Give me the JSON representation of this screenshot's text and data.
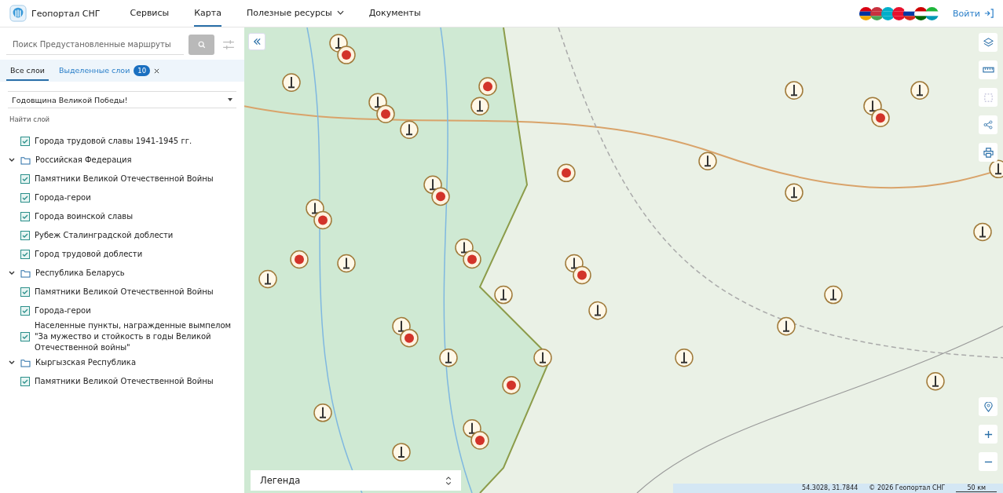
{
  "header": {
    "logo": "Геопортал СНГ",
    "nav": [
      {
        "label": "Сервисы",
        "selected": false,
        "dropdown": false
      },
      {
        "label": "Карта",
        "selected": true,
        "dropdown": false
      },
      {
        "label": "Полезные ресурсы",
        "selected": false,
        "dropdown": true
      },
      {
        "label": "Документы",
        "selected": false,
        "dropdown": false
      }
    ],
    "login": "Войти"
  },
  "sidebar": {
    "search": {
      "placeholder": "Поиск Предустановленные маршруты"
    },
    "tabs": [
      {
        "label": "Все слои",
        "selected": true
      },
      {
        "label": "Выделенные слои",
        "selected": false,
        "count": "10"
      }
    ],
    "preset": "Годовщина Великой Победы!",
    "layer_search": {
      "placeholder": "Найти слой"
    },
    "layers": [
      {
        "kind": "layer",
        "label": "Города трудовой славы 1941-1945 гг.",
        "checked": true
      },
      {
        "kind": "folder",
        "label": "Российская Федерация",
        "expanded": true,
        "children": [
          {
            "label": "Памятники Великой Отечественной Войны",
            "checked": true
          },
          {
            "label": "Города-герои",
            "checked": true
          },
          {
            "label": "Города воинской славы",
            "checked": true
          },
          {
            "label": "Рубеж Сталинградской доблести",
            "checked": true
          },
          {
            "label": "Город трудовой доблести",
            "checked": true
          }
        ]
      },
      {
        "kind": "folder",
        "label": "Республика Беларусь",
        "expanded": true,
        "children": [
          {
            "label": "Памятники Великой Отечественной Войны",
            "checked": true
          },
          {
            "label": "Города-герои",
            "checked": true
          },
          {
            "label": "Населенные пункты, награжденные вымпелом \"За мужество и стойкость в годы Великой Отечественной войны\"",
            "checked": true
          }
        ]
      },
      {
        "kind": "folder",
        "label": "Кыргызская Республика",
        "expanded": true,
        "children": [
          {
            "label": "Памятники Великой Отечественной Войны",
            "checked": true
          }
        ]
      }
    ]
  },
  "map": {
    "legend": "Легенда",
    "coordinates": "54.3028, 31.7844",
    "copyright": "© 2026 Геопортал СНГ",
    "scale": "50 км"
  }
}
